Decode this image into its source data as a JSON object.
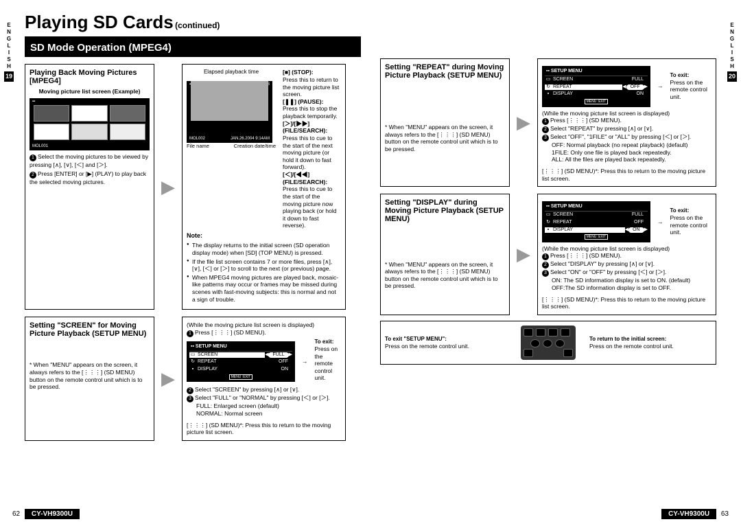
{
  "lang_label": "ENGLISH",
  "left_page_tab": "19",
  "right_page_tab": "20",
  "main_title": "Playing SD Cards",
  "continued": "(continued)",
  "section_title": "SD Mode Operation (MPEG4)",
  "model": "CY-VH9300U",
  "page_left": "62",
  "page_right": "63",
  "block1": {
    "heading": "Playing Back Moving Pictures [MPEG4]",
    "screen_caption": "Moving picture list screen (Example)",
    "file_label": "MOL001",
    "step1": "Select the moving pictures to be viewed by pressing [∧], [∨], [＜] and [＞].",
    "step2": "Press [ENTER] or [▶] (PLAY) to play back the selected moving pictures."
  },
  "playback": {
    "elapsed_label": "Elapsed playback time",
    "screen_top": "0000 04:3",
    "file_name_label": "File name",
    "creation_label": "Creation date/time",
    "file_name": "MOL002",
    "creation": "JAN.26.2004 9:14AM",
    "stop_h": "[■] (STOP):",
    "stop_t": "Press this to return to the moving picture list screen.",
    "pause_h": "[❚❚] (PAUSE):",
    "pause_t": "Press this to stop the playback temporarily.",
    "fwd_h": "[＞]/[▶▶] (FILE/SEARCH):",
    "fwd_t": "Press this to cue to the start of the next moving picture (or hold it down to fast forward).",
    "rev_h": "[＜]/[◀◀] (FILE/SEARCH):",
    "rev_t": "Press this to cue to the start of the moving picture now playing back (or hold it down to fast reverse).",
    "note_h": "Note:",
    "note1": "The display returns to the initial screen (SD operation display mode) when [SD] (TOP MENU) is pressed.",
    "note2": "If the file list screen contains 7 or more files, press [∧], [∨], [＜] or [＞] to scroll to the next (or previous) page.",
    "note3": "When MPEG4 moving pictures are played back, mosaic-like patterns may occur or frames may be missed during scenes with fast-moving subjects: this is normal and not a sign of trouble."
  },
  "screen_setting": {
    "heading": "Setting \"SCREEN\" for Moving Picture Playback (SETUP MENU)",
    "menu_note": "* When \"MENU\" appears on the screen, it always refers to the [⋮⋮⋮] (SD MENU) button on the remote control unit which is to be pressed.",
    "intro": "(While the moving picture list screen is displayed)",
    "step1": "Press [⋮⋮⋮] (SD MENU).",
    "step2": "Select \"SCREEN\" by pressing [∧] or [∨].",
    "step3": "Select \"FULL\" or \"NORMAL\" by pressing [＜] or [＞].",
    "full": "FULL:    Enlarged screen (default)",
    "normal": "NORMAL: Normal screen",
    "return_note": "[⋮⋮⋮] (SD MENU)*: Press this to return to the moving picture list screen.",
    "exit_h": "To exit:",
    "exit_t": "Press          on the remote control unit."
  },
  "setup_menu": {
    "title": "SETUP MENU",
    "screen": "SCREEN",
    "screen_v": "FULL",
    "repeat": "REPEAT",
    "repeat_v": "OFF",
    "display": "DISPLAY",
    "display_v": "ON",
    "exit": "MENU :EXIT"
  },
  "repeat_setting": {
    "heading": "Setting \"REPEAT\" during Moving Picture Playback (SETUP MENU)",
    "menu_note": "* When \"MENU\" appears on the screen, it always refers to the [⋮⋮⋮] (SD MENU) button on the remote control unit which is to be pressed.",
    "intro": "(While the moving picture list screen is displayed)",
    "step1": "Press [⋮⋮⋮] (SD MENU).",
    "step2": "Select \"REPEAT\" by pressing [∧] or [∨].",
    "step3": "Select \"OFF\", \"1FILE\" or \"ALL\" by pressing [＜] or [＞].",
    "off": "OFF:    Normal playback (no repeat playback) (default)",
    "file1": "1FILE:  Only one file is played back repeatedly.",
    "all": "ALL:    All the files are played back repeatedly.",
    "return_note": "[⋮⋮⋮] (SD MENU)*: Press this to return to the moving picture list screen.",
    "exit_h": "To exit:",
    "exit_t": "Press          on the remote control unit."
  },
  "display_setting": {
    "heading": "Setting \"DISPLAY\" during Moving Picture Playback (SETUP MENU)",
    "menu_note": "* When \"MENU\" appears on the screen, it always refers to the [⋮⋮⋮] (SD MENU) button on the remote control unit which is to be pressed.",
    "intro": "(While the moving picture list screen is displayed)",
    "step1": "Press [⋮⋮⋮] (SD MENU).",
    "step2": "Select \"DISPLAY\" by pressing [∧] or [∨].",
    "step3": "Select \"ON\" or \"OFF\" by pressing [＜] or [＞].",
    "on": "ON: The SD information display is set to ON. (default)",
    "off": "OFF:The SD information display is set to OFF.",
    "return_note": "[⋮⋮⋮] (SD MENU)*: Press this to return to the moving picture list screen.",
    "exit_h": "To exit:",
    "exit_t": "Press          on the remote control unit."
  },
  "bottom": {
    "exit_h": "To exit \"SETUP MENU\":",
    "exit_t": "Press          on the remote control unit.",
    "return_h": "To return to the initial screen:",
    "return_t": "Press          on the remote control unit."
  }
}
